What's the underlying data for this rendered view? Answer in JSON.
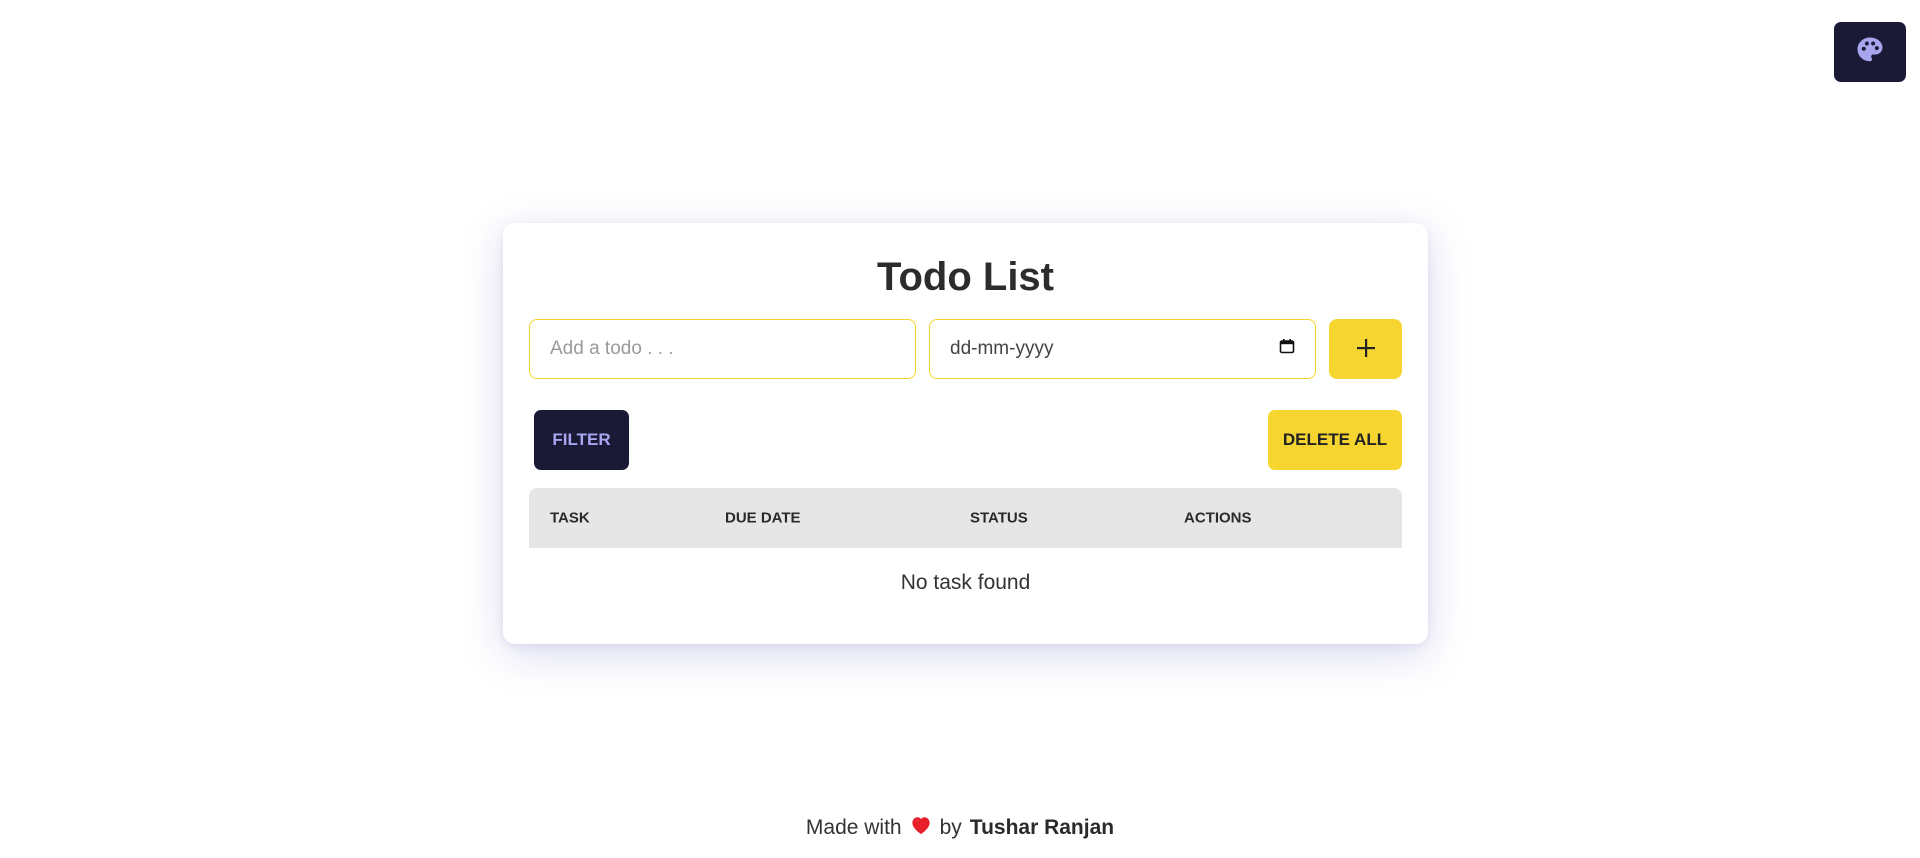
{
  "theme_toggle": {
    "icon": "palette-icon"
  },
  "card": {
    "title": "Todo List",
    "todo_input": {
      "placeholder": "Add a todo . . .",
      "value": ""
    },
    "date_input": {
      "placeholder": "dd-mm-yyyy",
      "icon": "calendar-icon"
    },
    "add_button": {
      "icon": "plus-icon"
    },
    "filter_button": "FILTER",
    "delete_all_button": "DELETE ALL",
    "table": {
      "columns": [
        "TASK",
        "DUE DATE",
        "STATUS",
        "ACTIONS"
      ],
      "rows": [],
      "empty_message": "No task found"
    }
  },
  "footer": {
    "prefix": "Made with",
    "icon": "heart-icon",
    "by": "by",
    "author": "Tushar Ranjan"
  },
  "colors": {
    "accent_yellow": "#f7d530",
    "dark_navy": "#1b1a36",
    "filter_text": "#a8a6ee",
    "header_gray": "#e6e6e6",
    "heart_red": "#e8202a"
  }
}
